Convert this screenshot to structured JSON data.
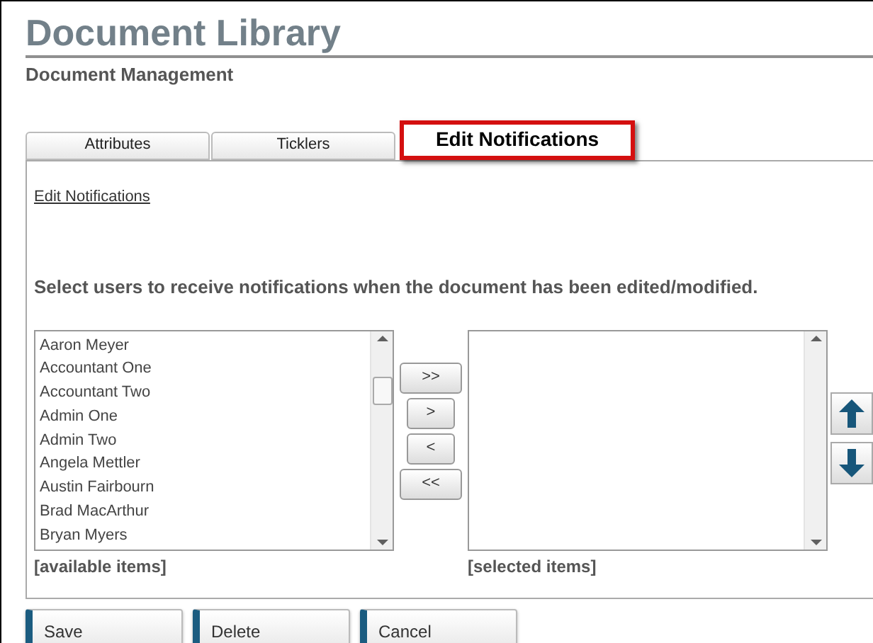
{
  "header": {
    "title": "Document Library",
    "subtitle": "Document Management"
  },
  "tabs": [
    {
      "label": "Attributes",
      "selected": false
    },
    {
      "label": "Ticklers",
      "selected": false
    },
    {
      "label": "Edit Notifications",
      "selected": true
    }
  ],
  "panel": {
    "link": "Edit Notifications",
    "instruction": "Select users to receive notifications when the document has been edited/modified.",
    "available": {
      "items": [
        "Aaron Meyer",
        "Accountant One",
        "Accountant Two",
        "Admin One",
        "Admin Two",
        "Angela Mettler",
        "Austin Fairbourn",
        "Brad MacArthur",
        "Bryan Myers"
      ],
      "caption": "[available items]"
    },
    "transfer_buttons": [
      ">>",
      ">",
      "<",
      "<<"
    ],
    "selected": {
      "caption": "[selected items]"
    }
  },
  "actions": [
    "Save",
    "Delete",
    "Cancel"
  ]
}
